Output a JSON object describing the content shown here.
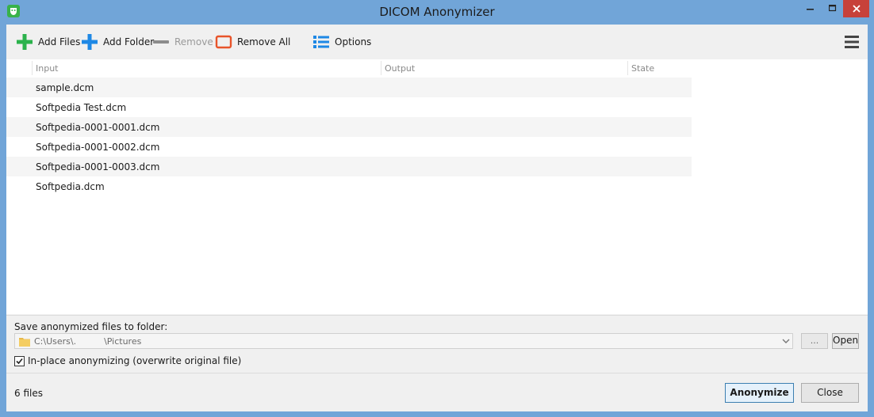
{
  "window": {
    "title": "DICOM Anonymizer"
  },
  "toolbar": {
    "add_files": "Add Files",
    "add_folder": "Add Folder",
    "remove": "Remove",
    "remove_all": "Remove All",
    "options": "Options",
    "icons": {
      "add_files": "plus-green-icon",
      "add_folder": "plus-blue-icon",
      "remove": "minus-icon",
      "remove_all": "empty-square-icon",
      "options": "list-icon",
      "menu": "hamburger-icon"
    }
  },
  "list": {
    "columns": [
      "Input",
      "Output",
      "State"
    ],
    "rows": [
      {
        "input": "sample.dcm",
        "output": "",
        "state": ""
      },
      {
        "input": "Softpedia Test.dcm",
        "output": "",
        "state": ""
      },
      {
        "input": "Softpedia-0001-0001.dcm",
        "output": "",
        "state": ""
      },
      {
        "input": "Softpedia-0001-0002.dcm",
        "output": "",
        "state": ""
      },
      {
        "input": "Softpedia-0001-0003.dcm",
        "output": "",
        "state": ""
      },
      {
        "input": "Softpedia.dcm",
        "output": "",
        "state": ""
      }
    ]
  },
  "output": {
    "label": "Save anonymized files to folder:",
    "path": "C:\\Users\\.          \\Pictures",
    "browse_label": "...",
    "open_label": "Open",
    "inplace_label": "In-place anonymizing (overwrite original file)",
    "inplace_checked": true
  },
  "status": {
    "count": "6 files"
  },
  "actions": {
    "anonymize": "Anonymize",
    "close": "Close"
  },
  "colors": {
    "accent_green": "#2bb24c",
    "accent_blue": "#1e88e5",
    "remove_all_orange": "#e8542a",
    "titlebar": "#71a5d8",
    "close_red": "#c7413a"
  }
}
